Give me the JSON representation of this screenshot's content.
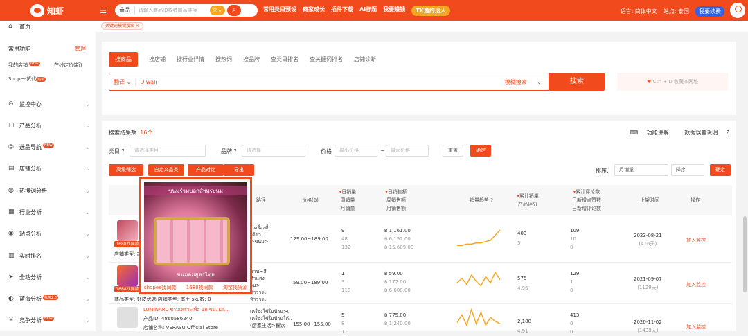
{
  "top": {
    "logo": "知虾",
    "menu_icon": "menu-icon",
    "search_type": "商品",
    "search_placeholder": "请输入商品ID或者商品链接",
    "nav": [
      "常用类目预设",
      "商家成长",
      "插件下载",
      "AI标题",
      "我要赚钱"
    ],
    "tk": "TK邀约达人",
    "lang": "语言: 简体中文",
    "site": "站点: 泰国",
    "renew": "我要续费"
  },
  "sidebar": {
    "home": "首页",
    "common": "常用功能",
    "manage": "管理",
    "my_shop": "我的店铺",
    "my_shop_badge": "NEW",
    "online_price": "在线定价(新)",
    "shopee": "Shopee货代",
    "shopee_badge": "热销",
    "items": [
      {
        "label": "监控中心"
      },
      {
        "label": "产品分析"
      },
      {
        "label": "选品导航",
        "badge": "NEW"
      },
      {
        "label": "店铺分析"
      },
      {
        "label": "热搜词分析"
      },
      {
        "label": "行业分析"
      },
      {
        "label": "站点分析"
      },
      {
        "label": "实时排名"
      },
      {
        "label": "全站分析"
      },
      {
        "label": "蓝海分析",
        "badge": "标签2.0"
      },
      {
        "label": "竞争分析",
        "badge": "NEW"
      }
    ]
  },
  "tagbar": {
    "tag": "关键词模糊搜索 ×"
  },
  "search": {
    "tabs": [
      "搜商品",
      "搜店铺",
      "搜行业详情",
      "搜热词",
      "搜品牌",
      "查类目排名",
      "查关键词排名",
      "店铺诊断"
    ],
    "translate": "翻译",
    "keyword": "Diwali",
    "fuzzy": "模糊搜索",
    "button": "搜索",
    "collect": "Ctrl + D 收藏本网址"
  },
  "results": {
    "label": "搜索结果数: ",
    "count": "16个",
    "func": "功能讲解",
    "data": "数据误差说明"
  },
  "filters": {
    "category": "类目",
    "cat_ph": "请选择类目",
    "brand": "品牌",
    "brand_ph": "请选择",
    "price": "价格",
    "min": "最小价格",
    "max": "最大价格",
    "tilde": "~",
    "reset": "重置",
    "confirm": "确定"
  },
  "actions": {
    "b1": "高级筛选",
    "b2": "自定义品类",
    "b3": "产品对比",
    "b4": "导出",
    "sort": "排序:",
    "sort1": "月销量",
    "sort2": "降序",
    "sort_ok": "确定"
  },
  "th": {
    "path": "路径",
    "price": "价格(฿)",
    "day_sales": "日销量",
    "week_sales": "周销量",
    "month_sales": "月销量",
    "day_rev": "日销售额",
    "week_rev": "周销售额",
    "month_rev": "月销售额",
    "trend": "销量趋势",
    "total_sales": "累计销量",
    "rating": "产品评分",
    "total_reviews": "累计评论数",
    "new_reviews": "日新增点赞数",
    "new_reviews2": "日新增评论数",
    "listed": "上架时间",
    "op": "操作"
  },
  "rows": [
    {
      "path": [
        "ระเครื่องดื่",
        "นเตียว...",
        "ช>ขนม>",
        "ิต)"
      ],
      "price": "129.00~189.00",
      "sales": [
        "9",
        "48",
        "132"
      ],
      "rev": [
        "฿ 1,161.00",
        "฿ 6,192.00",
        "฿ 15,609.00"
      ],
      "total": "403",
      "rating": "5",
      "reviews": [
        "109",
        "10",
        "0"
      ],
      "date": "2023-08-21",
      "days": "(416天)",
      "label1688": "1688找同款",
      "monitor": "加入监控",
      "shop_type": "店铺类型: 本土",
      "trend": [
        2,
        2,
        3,
        3,
        4,
        4,
        5,
        6,
        10,
        14
      ]
    },
    {
      "path": [
        "นาน~สี",
        "ทำแสง",
        "วน>",
        "ห้าวาระ",
        "ห้าวาระ"
      ],
      "price": "59.00~189.00",
      "sales": [
        "1",
        "3",
        "110"
      ],
      "rev": [
        "฿ 59.00",
        "฿ 177.00",
        "฿ 6,608.00"
      ],
      "total": "575",
      "rating": "4.95",
      "reviews": [
        "129",
        "1",
        "0"
      ],
      "date": "2021-09-07",
      "days": "(1129天)",
      "label1688": "1688找同款",
      "monitor": "加入监控",
      "meta": "商品类型: 虾皮优选  店铺类型: 本土  sku数: 0",
      "trend": [
        5,
        8,
        4,
        10,
        6,
        3,
        9,
        5,
        12,
        7
      ]
    },
    {
      "brand": "LUMINARC ชามเคราะเพื่อ 18 ซม. DI...",
      "pid": "产品ID: 4860586240",
      "shop": "店铺名称: VERASU Official Store",
      "path": [
        "เครื่องใช้ในบ้าน>เ",
        "เครื่องใช้ในบ้านได้...",
        "(厨家生活>餐饮"
      ],
      "price": "155.00~155.00",
      "sales": [
        "5",
        "8",
        "11"
      ],
      "rev": [
        "฿ 775.00",
        "฿ 1,240.00",
        ""
      ],
      "total": "2,188",
      "rating": "4.91",
      "reviews": [
        "413",
        "0",
        "0"
      ],
      "date": "2020-11-02",
      "days": "(1438天)",
      "monitor": "加入监控",
      "trend": [
        4,
        10,
        2,
        14,
        3,
        12,
        2,
        8,
        5,
        3
      ]
    }
  ],
  "popup": {
    "top_text": "ขนมร่วมบอกส์ฯพระนม",
    "bottom_text": "ขนมอมสูตรไทย",
    "links": [
      "shopee找同款",
      "1688找同款",
      "淘宝找货源"
    ]
  }
}
